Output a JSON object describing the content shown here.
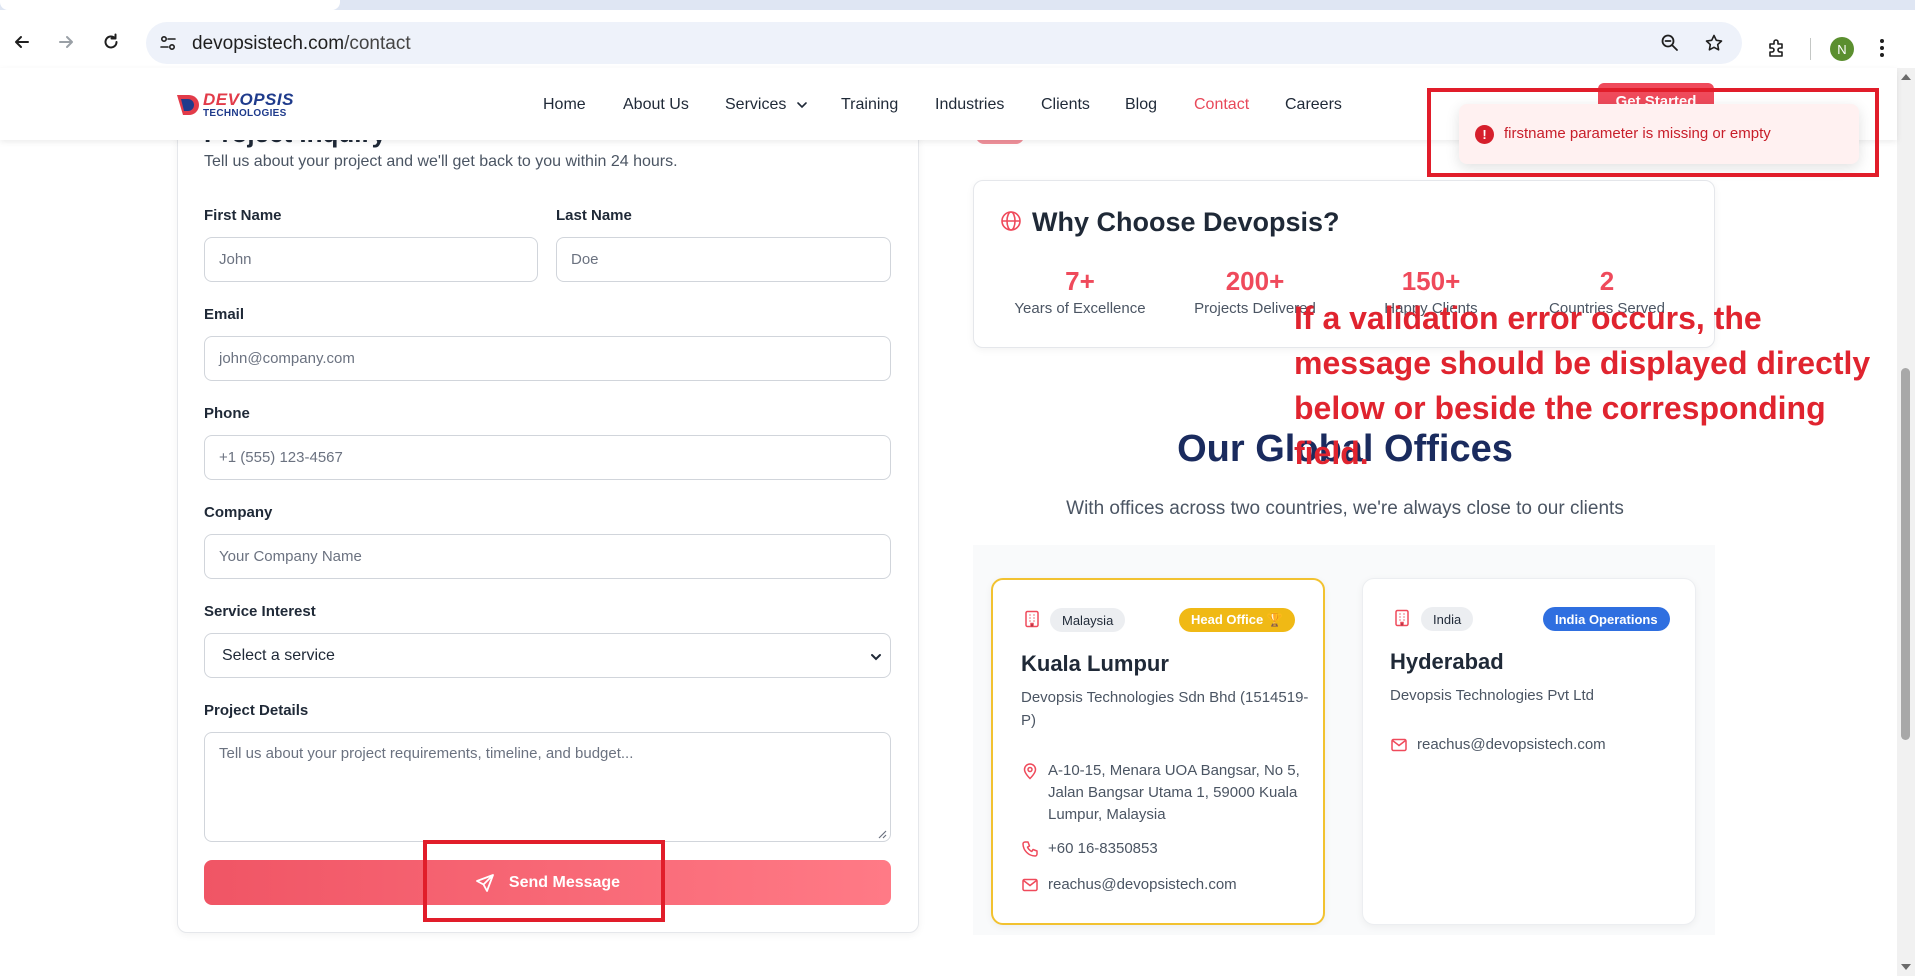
{
  "browser": {
    "url_host": "devopsistech.com",
    "url_path": "/contact",
    "profile_initial": "N"
  },
  "header": {
    "logo_dev": "DEV",
    "logo_opsis": "OPSIS",
    "logo_sub": "TECHNOLOGIES",
    "nav": {
      "home": "Home",
      "about": "About Us",
      "services": "Services",
      "training": "Training",
      "industries": "Industries",
      "clients": "Clients",
      "blog": "Blog",
      "contact": "Contact",
      "careers": "Careers"
    },
    "cta": "Get Started"
  },
  "toast": {
    "message": "firstname parameter is missing or empty"
  },
  "annotation": {
    "text": "If a validation error occurs, the message should be displayed directly below or beside the corresponding field."
  },
  "form": {
    "title": "Project Inquiry",
    "subtitle": "Tell us about your project and we'll get back to you within 24 hours.",
    "first_name_label": "First Name",
    "first_name_placeholder": "John",
    "last_name_label": "Last Name",
    "last_name_placeholder": "Doe",
    "email_label": "Email",
    "email_placeholder": "john@company.com",
    "phone_label": "Phone",
    "phone_placeholder": "+1 (555) 123-4567",
    "company_label": "Company",
    "company_placeholder": "Your Company Name",
    "service_label": "Service Interest",
    "service_selected": "Select a service",
    "details_label": "Project Details",
    "details_placeholder": "Tell us about your project requirements, timeline, and budget...",
    "submit": "Send Message"
  },
  "why": {
    "title": "Why Choose Devopsis?",
    "stats": [
      {
        "value": "7+",
        "label": "Years of Excellence"
      },
      {
        "value": "200+",
        "label": "Projects Delivered"
      },
      {
        "value": "150+",
        "label": "Happy Clients"
      },
      {
        "value": "2",
        "label": "Countries Served"
      }
    ]
  },
  "offices": {
    "title": "Our Global Offices",
    "subtitle": "With offices across two countries, we're always close to our clients",
    "cards": [
      {
        "country": "Malaysia",
        "badge": "Head Office 🏆",
        "city": "Kuala Lumpur",
        "company": "Devopsis Technologies Sdn Bhd (1514519-P)",
        "address": "A-10-15, Menara UOA Bangsar, No 5, Jalan Bangsar Utama 1, 59000 Kuala Lumpur, Malaysia",
        "phone": "+60 16-8350853",
        "email": "reachus@devopsistech.com"
      },
      {
        "country": "India",
        "badge": "India Operations",
        "city": "Hyderabad",
        "company": "Devopsis Technologies Pvt Ltd",
        "email": "reachus@devopsistech.com"
      }
    ]
  },
  "colors": {
    "accent": "#ef4a5b",
    "navy": "#1a2b5e",
    "annotation_red": "#e11d2a",
    "head_office_badge": "#f0b915",
    "india_badge": "#2f6fe0"
  }
}
